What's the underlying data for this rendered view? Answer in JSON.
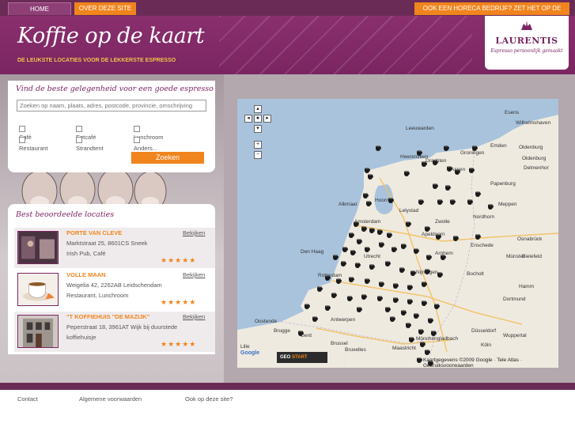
{
  "nav": {
    "home": "HOME",
    "about": "OVER DEZE SITE",
    "horeca": "OOK EEN HORECA BEDRIJF? ZET HET OP DE KAART"
  },
  "header": {
    "logo": "Koffie op de kaart",
    "tagline": "DE LEUKSTE LOCATIES VOOR DE LEKKERSTE ESPRESSO"
  },
  "brand": {
    "name": "LAURENTIS",
    "slogan": "Espresso persoonlijk gemaakt"
  },
  "search": {
    "title": "Vind de beste gelegenheid voor een goede espresso",
    "placeholder": "Zoeken op naam, plaats, adres, postcode, provincie, omschrijving",
    "options": [
      "Café",
      "Eetcafé",
      "Lunchroom",
      "Restaurant",
      "Strandtent",
      "Anders..."
    ],
    "button": "Zoeken"
  },
  "rated": {
    "title": "Best beoordeelde locaties",
    "view_label": "Bekijken",
    "items": [
      {
        "name": "PORTE VAN CLEVE",
        "address": "Marktstraat 25, 8601CS Sneek",
        "type": "Irish Pub, Café",
        "stars": "★★★★★"
      },
      {
        "name": "VOLLE MAAN",
        "address": "Weigelia 42, 2262AB Leidschendam",
        "type": "Restaurant, Lunchroom",
        "stars": "★★★★★"
      },
      {
        "name": "\"T KOFFIEHUIS \"DE MAZIJK\"",
        "address": "Peperstraat 18, 3961AT Wijk bij duurstede",
        "type": "koffiehuisje",
        "stars": "★★★★★"
      }
    ]
  },
  "map": {
    "places": [
      "Esens",
      "Wilhelmshaven",
      "Leeuwarden",
      "Groningen",
      "Emden",
      "Oldenburg",
      "Oldenburg",
      "Delmenhor",
      "Heerenveen",
      "Assen",
      "Drachten",
      "Papenburg",
      "Alkmaar",
      "Hoorn",
      "Lelystad",
      "Meppen",
      "Nordhorn",
      "Amsterdam",
      "Zwolle",
      "Apeldoorn",
      "Enschede",
      "Osnabrück",
      "Den Haag",
      "Utrecht",
      "Arnhem",
      "Münster",
      "Bielefeld",
      "Rotterdam",
      "Nijmegen",
      "Bocholt",
      "Hamm",
      "Dortmund",
      "Oostende",
      "Antwerpen",
      "Düsseldorf",
      "Brugge",
      "Gent",
      "Mönchengladbach",
      "Wuppertal",
      "Brussel",
      "Bruxelles",
      "Maastricht",
      "Köln",
      "Lille"
    ],
    "zoom_in": "+",
    "zoom_out": "−",
    "powered": "Google",
    "geo_a": "GEO",
    "geo_b": "START",
    "copyright": "Kaartgegevens ©2009 Google · Tele Atlas · Gebruiksvoorwaarden"
  },
  "footer": {
    "contact": "Contact",
    "terms": "Algemene voorwaarden",
    "own_site": "Ook op deze site?"
  }
}
